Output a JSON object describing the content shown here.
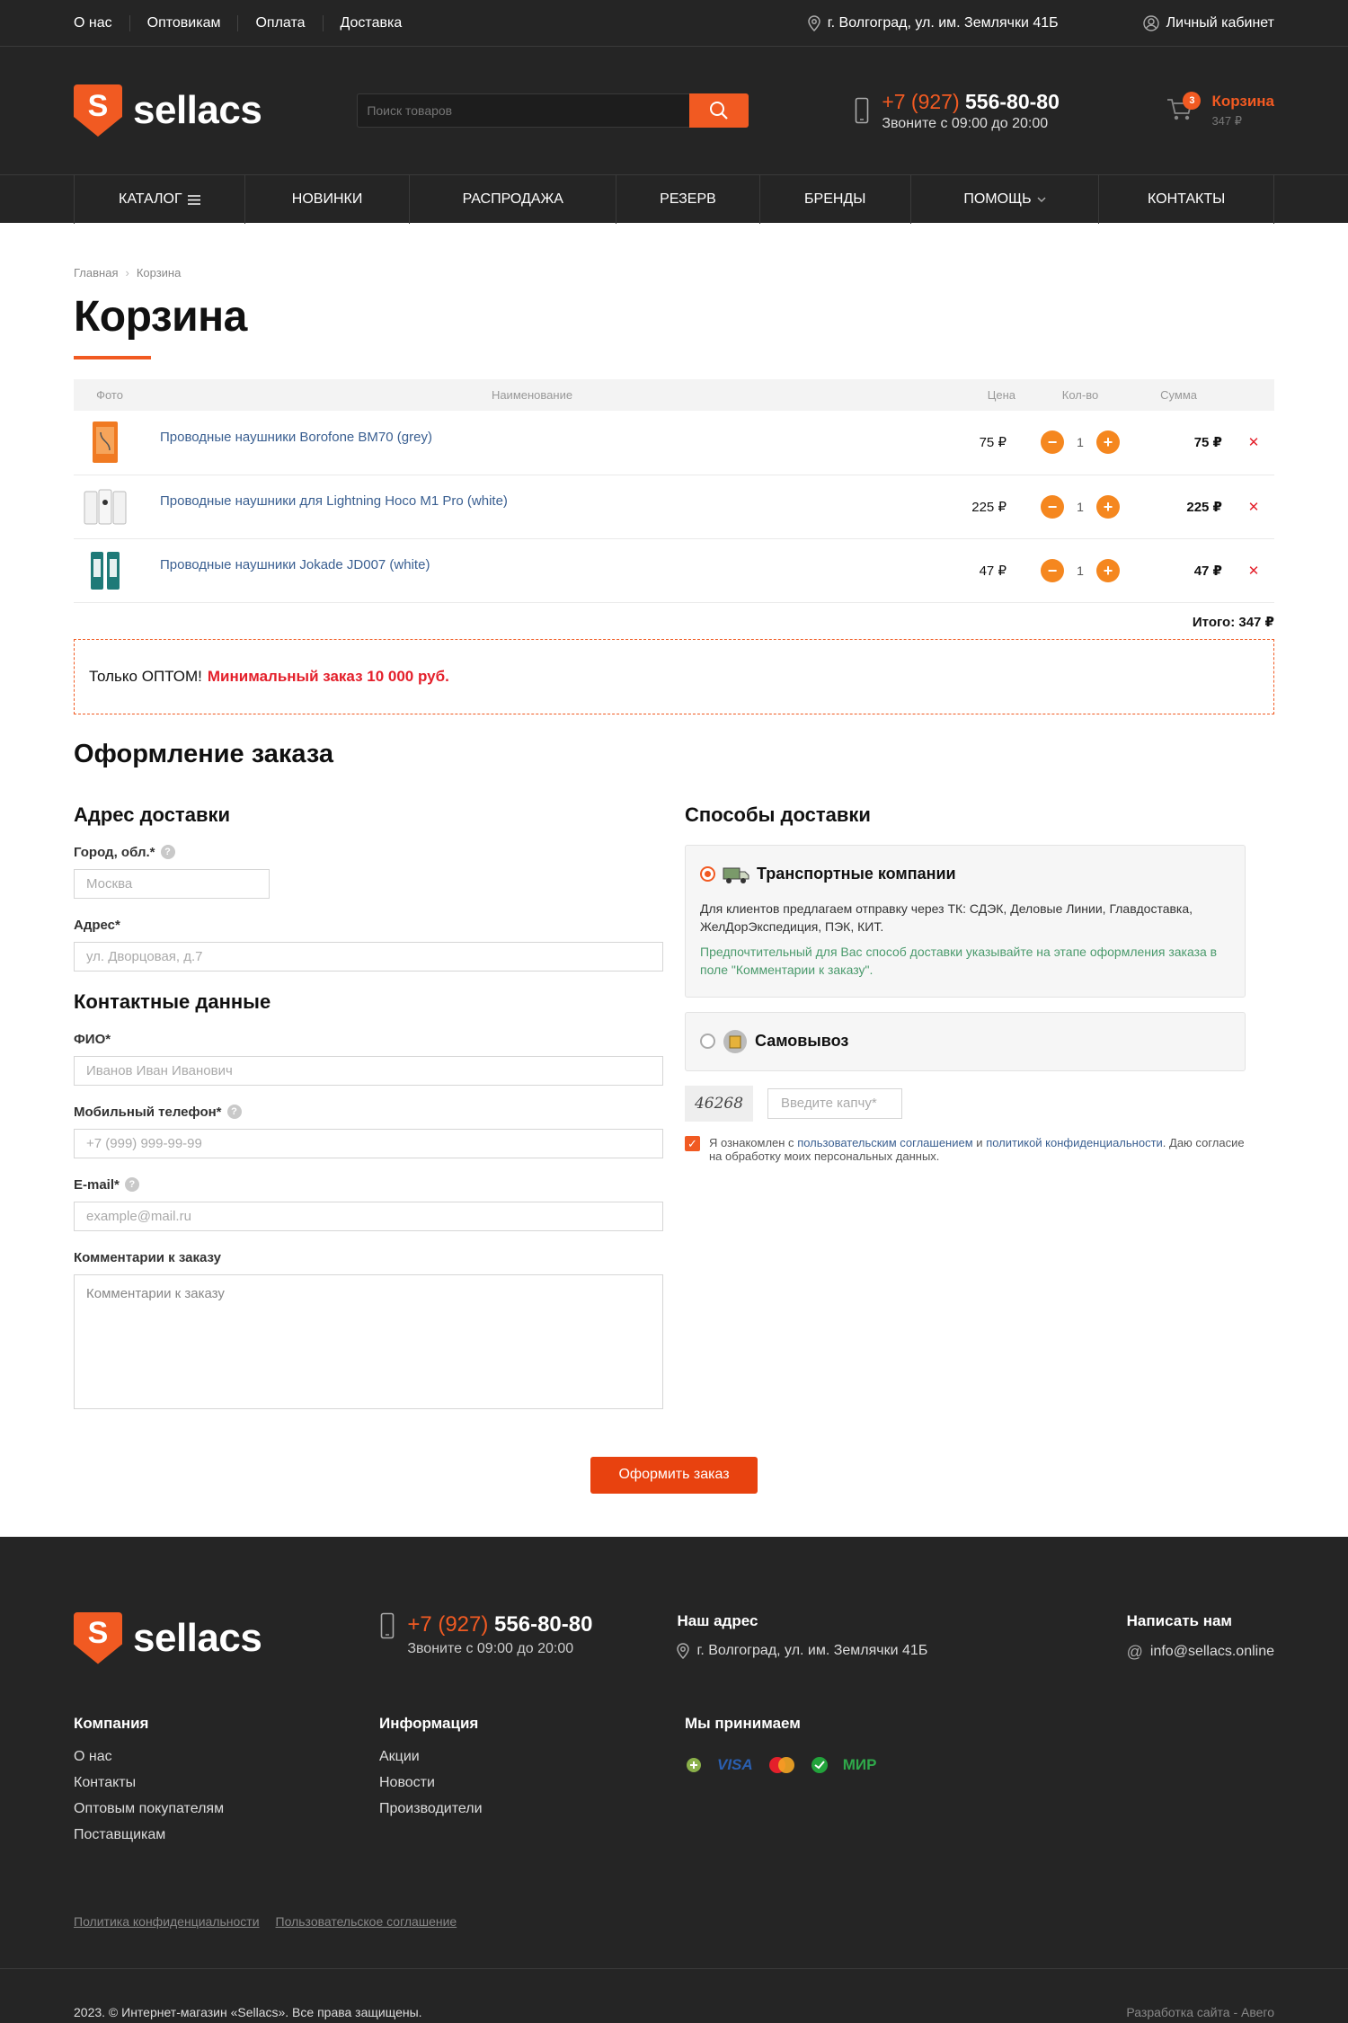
{
  "topbar": {
    "links": [
      "О нас",
      "Оптовикам",
      "Оплата",
      "Доставка"
    ],
    "address": "г. Волгоград, ул. им. Землячки 41Б",
    "account": "Личный кабинет"
  },
  "header": {
    "logo_text": "sellacs",
    "logo_glyph": "S",
    "search_placeholder": "Поиск товаров",
    "phone_code": "+7 (927)",
    "phone_number": "556-80-80",
    "phone_hours": "Звоните с 09:00 до 20:00",
    "cart_label": "Корзина",
    "cart_sum": "347 ₽",
    "cart_count": "3"
  },
  "nav": {
    "items": [
      "КАТАЛОГ",
      "НОВИНКИ",
      "РАСПРОДАЖА",
      "РЕЗЕРВ",
      "БРЕНДЫ",
      "ПОМОЩЬ",
      "КОНТАКТЫ"
    ]
  },
  "breadcrumb": {
    "home": "Главная",
    "current": "Корзина"
  },
  "page_title": "Корзина",
  "cart": {
    "columns": {
      "photo": "Фото",
      "name": "Наименование",
      "price": "Цена",
      "qty": "Кол-во",
      "sum": "Сумма"
    },
    "rows": [
      {
        "name": "Проводные наушники Borofone BM70 (grey)",
        "price": "75 ₽",
        "qty": "1",
        "sum": "75 ₽"
      },
      {
        "name": "Проводные наушники для Lightning Hoco M1 Pro (white)",
        "price": "225 ₽",
        "qty": "1",
        "sum": "225 ₽"
      },
      {
        "name": "Проводные наушники Jokade JD007 (white)",
        "price": "47 ₽",
        "qty": "1",
        "sum": "47 ₽"
      }
    ],
    "total": "Итого: 347 ₽"
  },
  "notice": {
    "text": "Только ОПТОМ!",
    "highlight": "Минимальный заказ 10 000 руб."
  },
  "checkout": {
    "title": "Оформление заказа",
    "delivery_address_title": "Адрес доставки",
    "city_label": "Город, обл.*",
    "city_placeholder": "Москва",
    "address_label": "Адрес*",
    "address_placeholder": "ул. Дворцовая, д.7",
    "contacts_title": "Контактные данные",
    "fio_label": "ФИО*",
    "fio_placeholder": "Иванов Иван Иванович",
    "phone_label": "Мобильный телефон*",
    "phone_placeholder": "+7 (999) 999-99-99",
    "email_label": "E-mail*",
    "email_placeholder": "example@mail.ru",
    "comment_label": "Комментарии к заказу",
    "comment_placeholder": "Комментарии к заказу",
    "delivery_methods_title": "Способы доставки",
    "method1_title": "Транспортные компании",
    "method1_text": "Для клиентов предлагаем отправку через ТК: СДЭК, Деловые Линии, Главдоставка, ЖелДорЭкспедиция, ПЭК, КИТ.",
    "method1_note": "Предпочтительный для Вас способ доставки указывайте на этапе оформления заказа в поле \"Комментарии к заказу\".",
    "method2_title": "Самовывоз",
    "captcha_code": "46268",
    "captcha_placeholder": "Введите капчу*",
    "agree_pre": "Я ознакомлен с",
    "agree_link1": "пользовательским соглашением",
    "agree_mid": "и",
    "agree_link2": "политикой конфиденциальности",
    "agree_post": ". Даю согласие на обработку моих персональных данных.",
    "submit": "Оформить заказ"
  },
  "footer": {
    "phone_code": "+7 (927)",
    "phone_number": "556-80-80",
    "phone_hours": "Звоните с 09:00 до 20:00",
    "address_title": "Наш адрес",
    "address": "г. Волгоград, ул. им. Землячки 41Б",
    "mail_title": "Написать нам",
    "mail": "info@sellacs.online",
    "company_title": "Компания",
    "company_links": [
      "О нас",
      "Контакты",
      "Оптовым покупателям",
      "Поставщикам"
    ],
    "info_title": "Информация",
    "info_links": [
      "Акции",
      "Новости",
      "Производители"
    ],
    "pay_title": "Мы принимаем",
    "pay_visa": "VISA",
    "pay_mir": "МИР",
    "policy": "Политика конфиденциальности",
    "agreement": "Пользовательское соглашение",
    "copyright": "2023. © Интернет-магазин «Sellacs». Все права защищены.",
    "developer": "Разработка сайта - Авего"
  },
  "colors": {
    "accent": "#f15a22",
    "dark": "#252525",
    "link": "#3a5f91",
    "danger": "#e4202b",
    "note": "#4a9a6c"
  }
}
